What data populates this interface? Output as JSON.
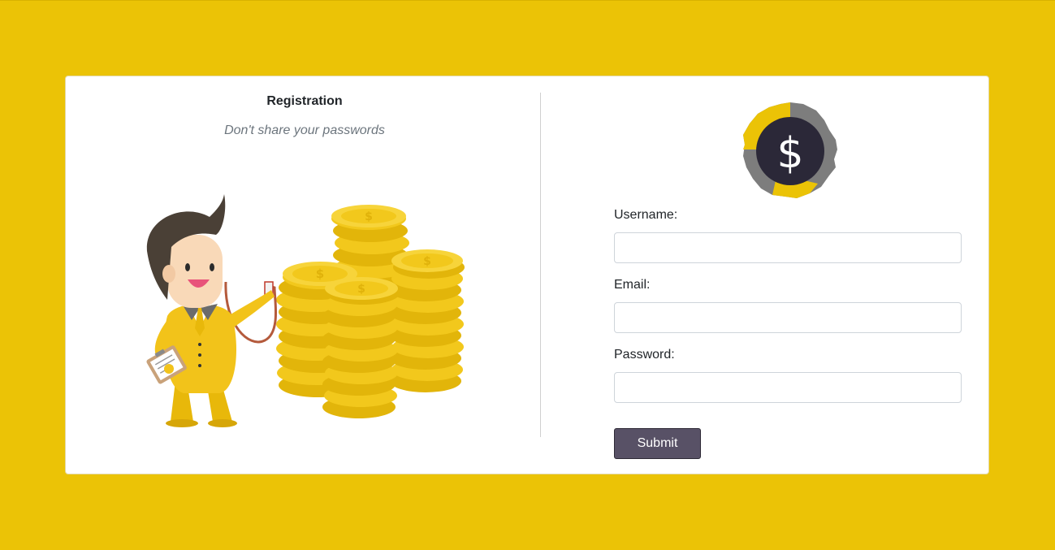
{
  "page": {
    "background_color": "#ebc306",
    "card_color": "#ffffff"
  },
  "left": {
    "title": "Registration",
    "subtitle": "Don't share your passwords",
    "illustration": "businessman-with-stethoscope-and-coin-stacks"
  },
  "right": {
    "logo": "dollar-coin-logo",
    "form": {
      "username_label": "Username:",
      "username_value": "",
      "email_label": "Email:",
      "email_value": "",
      "password_label": "Password:",
      "password_value": "",
      "submit_label": "Submit",
      "submit_color": "#585166"
    }
  }
}
